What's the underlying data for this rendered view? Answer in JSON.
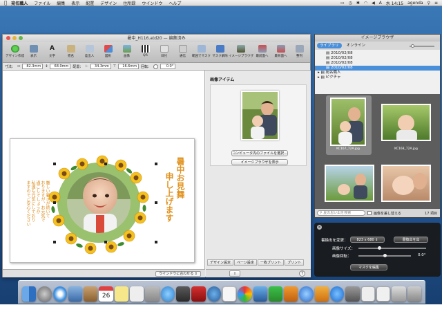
{
  "menubar": {
    "app": "宛名職人",
    "items": [
      "ファイル",
      "編集",
      "表示",
      "配置",
      "デザイン",
      "住所録",
      "ウインドウ",
      "ヘルプ"
    ],
    "clock": "水 14:15",
    "user": "agenda"
  },
  "window": {
    "title": "暑中_H116.atd20 — 編集済み",
    "toolbar": [
      "デザイン作成",
      "表示",
      "文字",
      "宛名",
      "差出人",
      "図形",
      "画像",
      "QR",
      "日付",
      "通信",
      "範囲でマスク",
      "マスク解除",
      "イメージブラウザ",
      "最前面へ",
      "最背面へ",
      "整列"
    ],
    "params": {
      "size_label": "寸法：",
      "w": "82.3mm",
      "h": "68.0mm",
      "pos_label": "配置：",
      "x": "34.3mm",
      "y": "16.6mm",
      "rot_label": "回転：",
      "rot": "0.0°"
    },
    "fit": "ウインドウに合わせる"
  },
  "card": {
    "heading": "暑中お見舞",
    "heading2": "申し上げます",
    "body": [
      "厳しい暑さが続いて",
      "おりますが、お元気で",
      "過ごしでしょうか",
      "私達も元気にしており",
      "ますのでご安心ください"
    ]
  },
  "panel": {
    "title": "画像アイテム",
    "btn_file": "コンピュータ内のファイルを選択...",
    "btn_browser": "イメージブラウザを表示",
    "tabs": [
      "デザイン設定",
      "ページ設定",
      "一枚プリント",
      "プリント"
    ]
  },
  "browser": {
    "title": "イメージブラウザ",
    "seg_library": "ライブラリ",
    "seg_online": "オンライン",
    "tree": [
      "2010/02/08",
      "2010/02/08",
      "2010/02/08",
      "2010/02/08",
      "宛名職人",
      "ピクチャ"
    ],
    "thumbs": [
      "KC167_72A.jpg",
      "KC168_72A.jpg",
      "",
      ""
    ],
    "search_placeholder": "夏の思い出を検索",
    "replace_label": "画像を差し替える",
    "count": "17 項目"
  },
  "hud": {
    "size_label": "書換出を変更：",
    "size_value": "823 x 680",
    "export_btn": "書換出を出",
    "img_size_label": "画像サイズ：",
    "rotate_label": "画像回転：",
    "rotate_value": "0.0°",
    "mask_btn": "マスクを編集"
  },
  "colors": {
    "accent": "#4a8fd9",
    "heading_orange": "#e0921f",
    "body_orange": "#d9891a"
  }
}
